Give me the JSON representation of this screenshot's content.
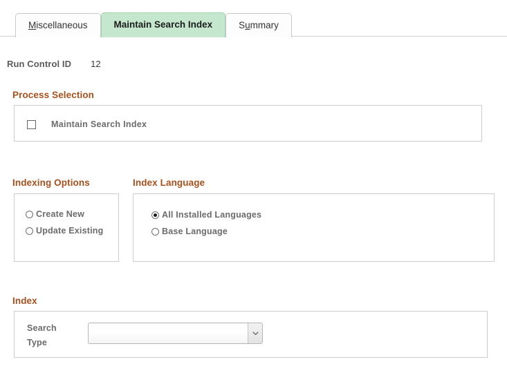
{
  "window": {
    "title": "Maintain Search Index"
  },
  "colors": {
    "group_heading": "#a9501d",
    "active_tab_bg": "#c4e7cd",
    "active_tab_border": "#9fd3ae",
    "panel_border": "#cccccc",
    "label_text": "#6b6b6b",
    "page_bg": "#ffffff"
  },
  "tabs": [
    {
      "label": "Miscellaneous",
      "accesskey": "M",
      "active": false,
      "name": "tab-miscellaneous"
    },
    {
      "label": "Maintain Search Index",
      "accesskey": "",
      "active": true,
      "name": "tab-maintain-search-index"
    },
    {
      "label": "Summary",
      "accesskey": "u",
      "active": false,
      "name": "tab-summary"
    }
  ],
  "run_control": {
    "label": "Run Control ID",
    "value": "12"
  },
  "process_selection": {
    "heading": "Process Selection",
    "items": [
      {
        "label": "Maintain Search Index",
        "checked": false
      }
    ]
  },
  "indexing_options": {
    "heading": "Indexing Options",
    "options": [
      {
        "label": "Create New",
        "selected": false
      },
      {
        "label": "Update Existing",
        "selected": false
      }
    ]
  },
  "index_language": {
    "heading": "Index Language",
    "options": [
      {
        "label": "All Installed Languages",
        "selected": true
      },
      {
        "label": "Base Language",
        "selected": false
      }
    ]
  },
  "index": {
    "heading": "Index",
    "search_type": {
      "label": "Search Type",
      "value": "",
      "placeholder": "",
      "dropdown_icon": "chevron-down-icon",
      "options": []
    }
  }
}
